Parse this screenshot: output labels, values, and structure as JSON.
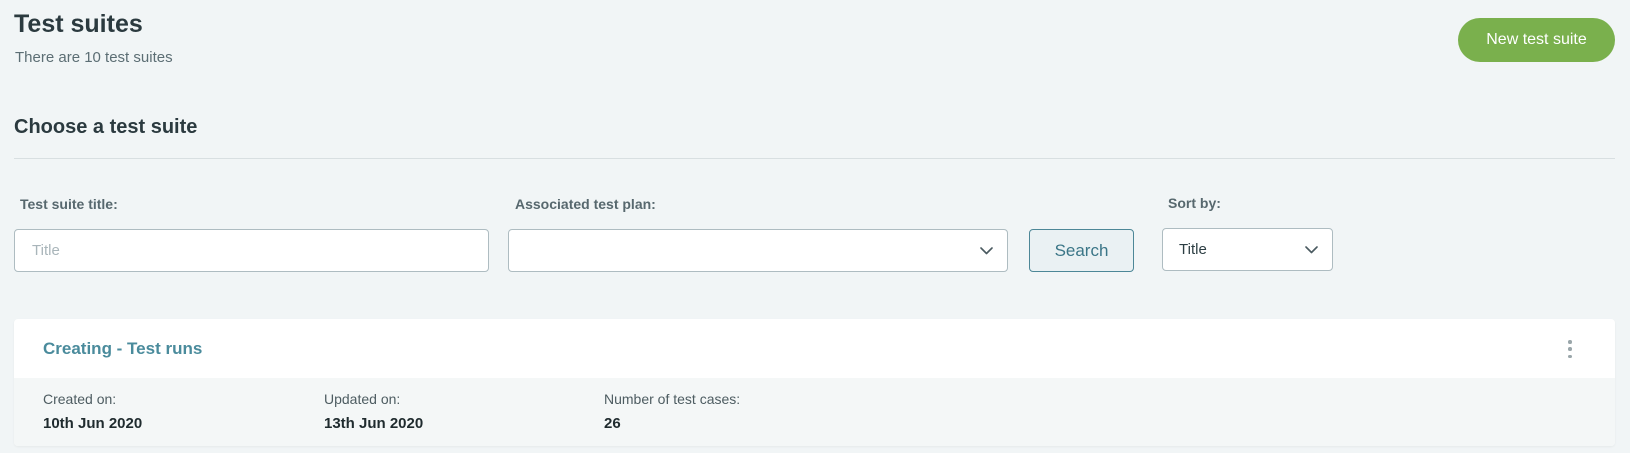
{
  "header": {
    "title": "Test suites",
    "subtitle": "There are 10 test suites",
    "new_button_label": "New test suite"
  },
  "section": {
    "title": "Choose a test suite"
  },
  "filters": {
    "title_label": "Test suite title:",
    "title_placeholder": "Title",
    "title_value": "",
    "plan_label": "Associated test plan:",
    "plan_selected": "",
    "search_label": "Search",
    "sort_label": "Sort by:",
    "sort_selected": "Title"
  },
  "suites": [
    {
      "title": "Creating - Test runs",
      "created_label": "Created on:",
      "created_value": "10th Jun 2020",
      "updated_label": "Updated on:",
      "updated_value": "13th Jun 2020",
      "cases_label": "Number of test cases:",
      "cases_value": "26"
    }
  ],
  "icons": {
    "dropdown": "chevron-down-icon",
    "menu": "kebab-menu-icon"
  },
  "colors": {
    "accent_green": "#7ab04d",
    "link_teal": "#4a8b9c",
    "background": "#f1f5f6"
  }
}
